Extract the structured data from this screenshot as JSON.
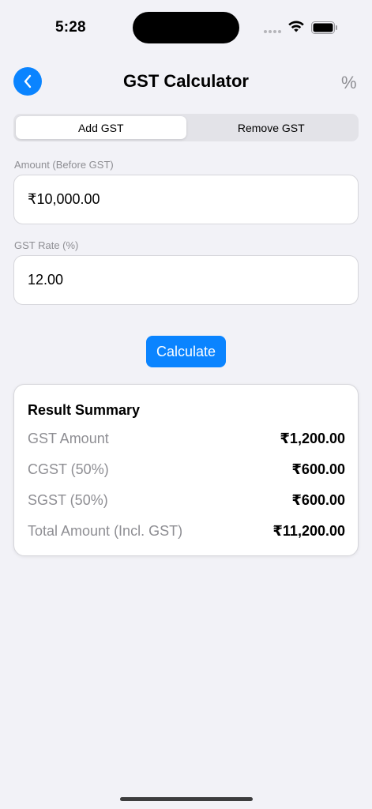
{
  "status_bar": {
    "time": "5:28"
  },
  "nav": {
    "title": "GST Calculator",
    "right_symbol": "%"
  },
  "segmented": {
    "add_label": "Add GST",
    "remove_label": "Remove GST",
    "selected": "Add GST"
  },
  "amount": {
    "label": "Amount (Before GST)",
    "value": "₹10,000.00"
  },
  "rate": {
    "label": "GST Rate (%)",
    "value": "12.00"
  },
  "calculate_label": "Calculate",
  "result": {
    "title": "Result Summary",
    "rows": [
      {
        "label": "GST Amount",
        "value": "₹1,200.00"
      },
      {
        "label": "CGST (50%)",
        "value": "₹600.00"
      },
      {
        "label": "SGST (50%)",
        "value": "₹600.00"
      },
      {
        "label": "Total Amount (Incl. GST)",
        "value": "₹11,200.00"
      }
    ]
  },
  "colors": {
    "accent": "#0A84FF",
    "background": "#F2F2F7",
    "secondary_text": "#8E8E93"
  }
}
